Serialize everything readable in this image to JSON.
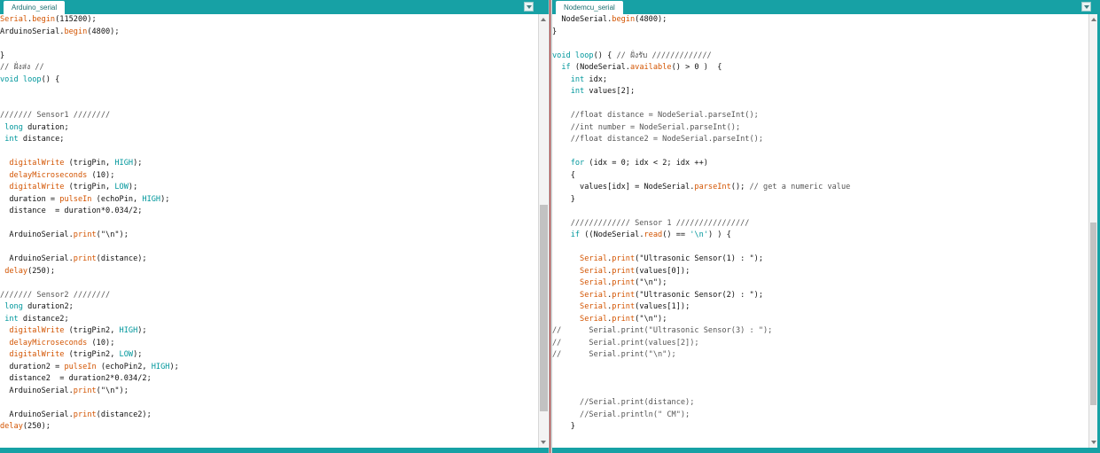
{
  "panes": [
    {
      "tab": "Arduino_serial",
      "lines": [
        [
          {
            "t": "Serial",
            "c": "o"
          },
          {
            "t": ".",
            "c": "p"
          },
          {
            "t": "begin",
            "c": "o"
          },
          {
            "t": "(115200);",
            "c": "p"
          }
        ],
        [
          {
            "t": "ArduinoSerial.",
            "c": "p"
          },
          {
            "t": "begin",
            "c": "o"
          },
          {
            "t": "(4800);",
            "c": "p"
          }
        ],
        [],
        [
          {
            "t": "}",
            "c": "p"
          }
        ],
        [
          {
            "t": "// ฝั่งส่ง //",
            "c": "c"
          }
        ],
        [
          {
            "t": "void",
            "c": "t"
          },
          {
            "t": " ",
            "c": "p"
          },
          {
            "t": "loop",
            "c": "t"
          },
          {
            "t": "() {",
            "c": "p"
          }
        ],
        [],
        [],
        [
          {
            "t": "/////// Sensor1 ////////",
            "c": "c"
          }
        ],
        [
          {
            "t": " ",
            "c": "p"
          },
          {
            "t": "long",
            "c": "t"
          },
          {
            "t": " duration;",
            "c": "p"
          }
        ],
        [
          {
            "t": " ",
            "c": "p"
          },
          {
            "t": "int",
            "c": "t"
          },
          {
            "t": " distance;",
            "c": "p"
          }
        ],
        [],
        [
          {
            "t": "  ",
            "c": "p"
          },
          {
            "t": "digitalWrite",
            "c": "o"
          },
          {
            "t": " (trigPin, ",
            "c": "p"
          },
          {
            "t": "HIGH",
            "c": "t"
          },
          {
            "t": ");",
            "c": "p"
          }
        ],
        [
          {
            "t": "  ",
            "c": "p"
          },
          {
            "t": "delayMicroseconds",
            "c": "o"
          },
          {
            "t": " (10);",
            "c": "p"
          }
        ],
        [
          {
            "t": "  ",
            "c": "p"
          },
          {
            "t": "digitalWrite",
            "c": "o"
          },
          {
            "t": " (trigPin, ",
            "c": "p"
          },
          {
            "t": "LOW",
            "c": "t"
          },
          {
            "t": ");",
            "c": "p"
          }
        ],
        [
          {
            "t": "  duration = ",
            "c": "p"
          },
          {
            "t": "pulseIn",
            "c": "o"
          },
          {
            "t": " (echoPin, ",
            "c": "p"
          },
          {
            "t": "HIGH",
            "c": "t"
          },
          {
            "t": ");",
            "c": "p"
          }
        ],
        [
          {
            "t": "  distance  = duration*0.034/2;",
            "c": "p"
          }
        ],
        [],
        [
          {
            "t": "  ArduinoSerial.",
            "c": "p"
          },
          {
            "t": "print",
            "c": "o"
          },
          {
            "t": "(\"\\n\");",
            "c": "p"
          }
        ],
        [],
        [
          {
            "t": "  ArduinoSerial.",
            "c": "p"
          },
          {
            "t": "print",
            "c": "o"
          },
          {
            "t": "(distance);",
            "c": "p"
          }
        ],
        [
          {
            "t": " ",
            "c": "p"
          },
          {
            "t": "delay",
            "c": "o"
          },
          {
            "t": "(250);",
            "c": "p"
          }
        ],
        [],
        [
          {
            "t": "/////// Sensor2 ////////",
            "c": "c"
          }
        ],
        [
          {
            "t": " ",
            "c": "p"
          },
          {
            "t": "long",
            "c": "t"
          },
          {
            "t": " duration2;",
            "c": "p"
          }
        ],
        [
          {
            "t": " ",
            "c": "p"
          },
          {
            "t": "int",
            "c": "t"
          },
          {
            "t": " distance2;",
            "c": "p"
          }
        ],
        [
          {
            "t": "  ",
            "c": "p"
          },
          {
            "t": "digitalWrite",
            "c": "o"
          },
          {
            "t": " (trigPin2, ",
            "c": "p"
          },
          {
            "t": "HIGH",
            "c": "t"
          },
          {
            "t": ");",
            "c": "p"
          }
        ],
        [
          {
            "t": "  ",
            "c": "p"
          },
          {
            "t": "delayMicroseconds",
            "c": "o"
          },
          {
            "t": " (10);",
            "c": "p"
          }
        ],
        [
          {
            "t": "  ",
            "c": "p"
          },
          {
            "t": "digitalWrite",
            "c": "o"
          },
          {
            "t": " (trigPin2, ",
            "c": "p"
          },
          {
            "t": "LOW",
            "c": "t"
          },
          {
            "t": ");",
            "c": "p"
          }
        ],
        [
          {
            "t": "  duration2 = ",
            "c": "p"
          },
          {
            "t": "pulseIn",
            "c": "o"
          },
          {
            "t": " (echoPin2, ",
            "c": "p"
          },
          {
            "t": "HIGH",
            "c": "t"
          },
          {
            "t": ");",
            "c": "p"
          }
        ],
        [
          {
            "t": "  distance2  = duration2*0.034/2;",
            "c": "p"
          }
        ],
        [
          {
            "t": "  ArduinoSerial.",
            "c": "p"
          },
          {
            "t": "print",
            "c": "o"
          },
          {
            "t": "(\"\\n\");",
            "c": "p"
          }
        ],
        [],
        [
          {
            "t": "  ArduinoSerial.",
            "c": "p"
          },
          {
            "t": "print",
            "c": "o"
          },
          {
            "t": "(distance2);",
            "c": "p"
          }
        ],
        [
          {
            "t": "delay",
            "c": "o"
          },
          {
            "t": "(250);",
            "c": "p"
          }
        ]
      ]
    },
    {
      "tab": "Nodemcu_serial",
      "lines": [
        [
          {
            "t": "  NodeSerial.",
            "c": "p"
          },
          {
            "t": "begin",
            "c": "o"
          },
          {
            "t": "(4800);",
            "c": "p"
          }
        ],
        [
          {
            "t": "}",
            "c": "p"
          }
        ],
        [],
        [
          {
            "t": "void",
            "c": "t"
          },
          {
            "t": " ",
            "c": "p"
          },
          {
            "t": "loop",
            "c": "t"
          },
          {
            "t": "() { ",
            "c": "p"
          },
          {
            "t": "// ฝั่งรับ /////////////",
            "c": "c"
          }
        ],
        [
          {
            "t": "  ",
            "c": "p"
          },
          {
            "t": "if",
            "c": "t"
          },
          {
            "t": " (NodeSerial.",
            "c": "p"
          },
          {
            "t": "available",
            "c": "o"
          },
          {
            "t": "() > 0 )  {",
            "c": "p"
          }
        ],
        [
          {
            "t": "    ",
            "c": "p"
          },
          {
            "t": "int",
            "c": "t"
          },
          {
            "t": " idx;",
            "c": "p"
          }
        ],
        [
          {
            "t": "    ",
            "c": "p"
          },
          {
            "t": "int",
            "c": "t"
          },
          {
            "t": " values[2];",
            "c": "p"
          }
        ],
        [],
        [
          {
            "t": "    //float distance = NodeSerial.parseInt();",
            "c": "c"
          }
        ],
        [
          {
            "t": "    //int number = NodeSerial.parseInt();",
            "c": "c"
          }
        ],
        [
          {
            "t": "    //float distance2 = NodeSerial.parseInt();",
            "c": "c"
          }
        ],
        [],
        [
          {
            "t": "    ",
            "c": "p"
          },
          {
            "t": "for",
            "c": "t"
          },
          {
            "t": " (idx = 0; idx < 2; idx ++)",
            "c": "p"
          }
        ],
        [
          {
            "t": "    {",
            "c": "p"
          }
        ],
        [
          {
            "t": "      values[idx] = NodeSerial.",
            "c": "p"
          },
          {
            "t": "parseInt",
            "c": "o"
          },
          {
            "t": "(); ",
            "c": "p"
          },
          {
            "t": "// get a numeric value",
            "c": "c"
          }
        ],
        [
          {
            "t": "    }",
            "c": "p"
          }
        ],
        [],
        [
          {
            "t": "    ///////////// Sensor 1 ////////////////",
            "c": "c"
          }
        ],
        [
          {
            "t": "    ",
            "c": "p"
          },
          {
            "t": "if",
            "c": "t"
          },
          {
            "t": " ((NodeSerial.",
            "c": "p"
          },
          {
            "t": "read",
            "c": "o"
          },
          {
            "t": "() == ",
            "c": "p"
          },
          {
            "t": "'\\n'",
            "c": "t"
          },
          {
            "t": ") ) {",
            "c": "p"
          }
        ],
        [],
        [
          {
            "t": "      ",
            "c": "p"
          },
          {
            "t": "Serial",
            "c": "o"
          },
          {
            "t": ".",
            "c": "p"
          },
          {
            "t": "print",
            "c": "o"
          },
          {
            "t": "(\"Ultrasonic Sensor(1) : \");",
            "c": "p"
          }
        ],
        [
          {
            "t": "      ",
            "c": "p"
          },
          {
            "t": "Serial",
            "c": "o"
          },
          {
            "t": ".",
            "c": "p"
          },
          {
            "t": "print",
            "c": "o"
          },
          {
            "t": "(values[0]);",
            "c": "p"
          }
        ],
        [
          {
            "t": "      ",
            "c": "p"
          },
          {
            "t": "Serial",
            "c": "o"
          },
          {
            "t": ".",
            "c": "p"
          },
          {
            "t": "print",
            "c": "o"
          },
          {
            "t": "(\"\\n\");",
            "c": "p"
          }
        ],
        [
          {
            "t": "      ",
            "c": "p"
          },
          {
            "t": "Serial",
            "c": "o"
          },
          {
            "t": ".",
            "c": "p"
          },
          {
            "t": "print",
            "c": "o"
          },
          {
            "t": "(\"Ultrasonic Sensor(2) : \");",
            "c": "p"
          }
        ],
        [
          {
            "t": "      ",
            "c": "p"
          },
          {
            "t": "Serial",
            "c": "o"
          },
          {
            "t": ".",
            "c": "p"
          },
          {
            "t": "print",
            "c": "o"
          },
          {
            "t": "(values[1]);",
            "c": "p"
          }
        ],
        [
          {
            "t": "      ",
            "c": "p"
          },
          {
            "t": "Serial",
            "c": "o"
          },
          {
            "t": ".",
            "c": "p"
          },
          {
            "t": "print",
            "c": "o"
          },
          {
            "t": "(\"\\n\");",
            "c": "p"
          }
        ],
        [
          {
            "t": "//      Serial.print(\"Ultrasonic Sensor(3) : \");",
            "c": "c"
          }
        ],
        [
          {
            "t": "//      Serial.print(values[2]);",
            "c": "c"
          }
        ],
        [
          {
            "t": "//      Serial.print(\"\\n\");",
            "c": "c"
          }
        ],
        [],
        [],
        [],
        [
          {
            "t": "      //Serial.print(distance);",
            "c": "c"
          }
        ],
        [
          {
            "t": "      //Serial.println(\" CM\");",
            "c": "c"
          }
        ],
        [
          {
            "t": "    }",
            "c": "p"
          }
        ]
      ]
    }
  ]
}
